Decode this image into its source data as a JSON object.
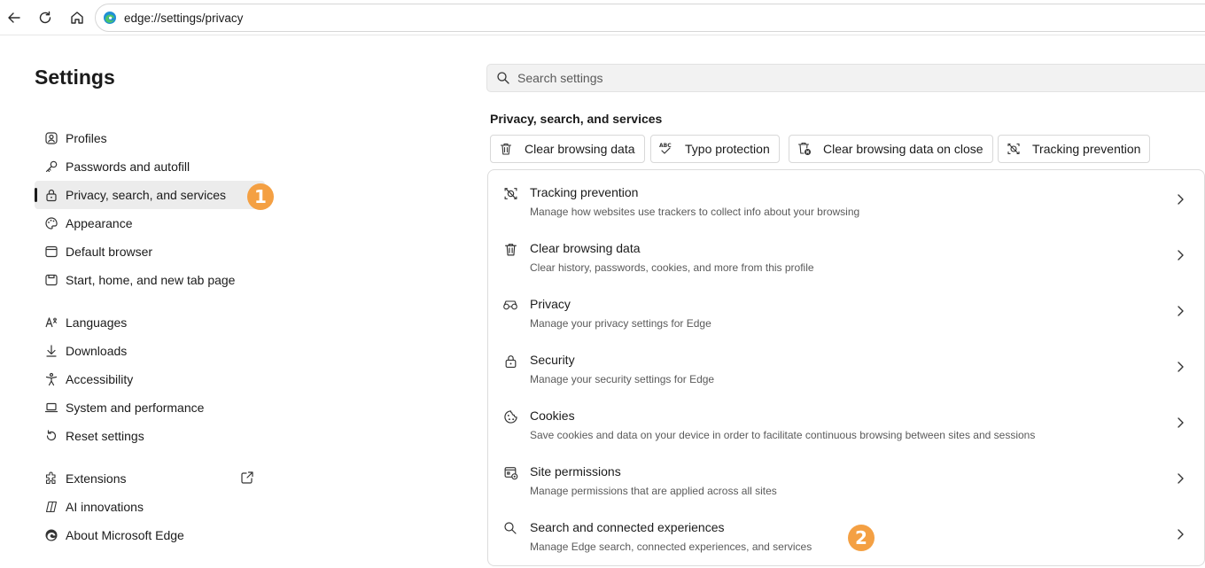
{
  "browser": {
    "address": "edge://settings/privacy"
  },
  "sidebar": {
    "title": "Settings",
    "items": [
      {
        "label": "Profiles",
        "icon": "profile-icon"
      },
      {
        "label": "Passwords and autofill",
        "icon": "key-icon"
      },
      {
        "label": "Privacy, search, and services",
        "icon": "lock-icon",
        "active": true
      },
      {
        "label": "Appearance",
        "icon": "palette-icon"
      },
      {
        "label": "Default browser",
        "icon": "browser-icon"
      },
      {
        "label": "Start, home, and new tab page",
        "icon": "home-page-icon"
      },
      {
        "label": "Languages",
        "icon": "languages-icon"
      },
      {
        "label": "Downloads",
        "icon": "download-icon"
      },
      {
        "label": "Accessibility",
        "icon": "accessibility-icon"
      },
      {
        "label": "System and performance",
        "icon": "laptop-icon"
      },
      {
        "label": "Reset settings",
        "icon": "reset-icon"
      },
      {
        "label": "Extensions",
        "icon": "extensions-icon"
      },
      {
        "label": "AI innovations",
        "icon": "copilot-icon"
      },
      {
        "label": "About Microsoft Edge",
        "icon": "edge-logo-icon"
      }
    ]
  },
  "badges": {
    "one": "1",
    "two": "2",
    "color": "#f4a043"
  },
  "main": {
    "search_placeholder": "Search settings",
    "section_title": "Privacy, search, and services",
    "chips": [
      {
        "label": "Clear browsing data",
        "icon": "trash-icon"
      },
      {
        "label": "Typo protection",
        "icon": "spellcheck-icon"
      },
      {
        "label": "Clear browsing data on close",
        "icon": "trash-close-icon"
      },
      {
        "label": "Tracking prevention",
        "icon": "tracking-icon"
      }
    ],
    "rows": [
      {
        "title": "Tracking prevention",
        "desc": "Manage how websites use trackers to collect info about your browsing",
        "icon": "tracking-icon"
      },
      {
        "title": "Clear browsing data",
        "desc": "Clear history, passwords, cookies, and more from this profile",
        "icon": "trash-icon"
      },
      {
        "title": "Privacy",
        "desc": "Manage your privacy settings for Edge",
        "icon": "glasses-icon"
      },
      {
        "title": "Security",
        "desc": "Manage your security settings for Edge",
        "icon": "lock-icon"
      },
      {
        "title": "Cookies",
        "desc": "Save cookies and data on your device in order to facilitate continuous browsing between sites and sessions",
        "icon": "cookie-icon"
      },
      {
        "title": "Site permissions",
        "desc": "Manage permissions that are applied across all sites",
        "icon": "site-permissions-icon"
      },
      {
        "title": "Search and connected experiences",
        "desc": "Manage Edge search, connected experiences, and services",
        "icon": "search-icon"
      }
    ]
  }
}
